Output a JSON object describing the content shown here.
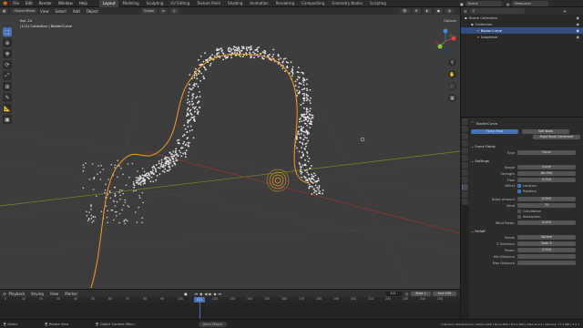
{
  "app": {
    "menus": [
      "File",
      "Edit",
      "Render",
      "Window",
      "Help"
    ],
    "workspaces": [
      "Layout",
      "Modeling",
      "Sculpting",
      "UV Editing",
      "Texture Paint",
      "Shading",
      "Animation",
      "Rendering",
      "Compositing",
      "Geometry Nodes",
      "Scripting"
    ],
    "active_workspace": "Layout",
    "scene_label": "Scene",
    "view_layer_label": "ViewLayer"
  },
  "viewport": {
    "mode": "Object Mode",
    "view_menus": [
      "View",
      "Select",
      "Add",
      "Object"
    ],
    "transform": "Global",
    "options_label": "Options",
    "fps_text": "fps: 24",
    "collection_text": "(111) Collection | BezierCurve"
  },
  "outliner": {
    "rows": [
      {
        "label": "Scene Collection",
        "indent": 0,
        "selected": false
      },
      {
        "label": "Collection",
        "indent": 1,
        "selected": false
      },
      {
        "label": "BezierCurve",
        "indent": 2,
        "selected": true
      },
      {
        "label": "Icosphere",
        "indent": 2,
        "selected": false
      }
    ]
  },
  "properties": {
    "object_name": "BezierCurve",
    "physics_buttons": [
      "Force Field",
      "Soft Body",
      "Rigid Body Constraint"
    ],
    "force_fields_header": "Force Fields",
    "type_label": "Type",
    "type_value": "Force",
    "settings_header": "Settings",
    "settings": [
      {
        "label": "Shape",
        "value": "Curve"
      },
      {
        "label": "Strength",
        "value": "80.000"
      },
      {
        "label": "Flow",
        "value": "0.000"
      }
    ],
    "affect_label": "Affect",
    "checks": [
      {
        "label": "Location",
        "on": true
      },
      {
        "label": "Rotation",
        "on": true
      }
    ],
    "noise_rows": [
      {
        "label": "Noise Amount",
        "value": "0.000"
      },
      {
        "label": "Seed",
        "value": "75"
      }
    ],
    "checks2": [
      {
        "label": "Gravitation",
        "on": false
      },
      {
        "label": "Absorption",
        "on": false
      }
    ],
    "wind_row": {
      "label": "Wind Factor",
      "value": "0.000"
    },
    "falloff_header": "Falloff",
    "falloff": [
      {
        "label": "Shape",
        "value": "Sphere"
      },
      {
        "label": "Z Direction",
        "value": "Both Z"
      },
      {
        "label": "Power",
        "value": "0.000"
      },
      {
        "label": "Min Distance",
        "value": ""
      },
      {
        "label": "Max Distance",
        "value": ""
      }
    ]
  },
  "timeline": {
    "menus": [
      "Playback",
      "Keying",
      "View",
      "Marker"
    ],
    "current_frame": "111",
    "start_label": "Start",
    "start_value": "1",
    "end_label": "End",
    "end_value": "250",
    "ruler": [
      "0",
      "10",
      "20",
      "30",
      "40",
      "50",
      "60",
      "70",
      "80",
      "90",
      "100",
      "110",
      "120",
      "130",
      "140",
      "150",
      "160",
      "170",
      "180",
      "190",
      "200",
      "210",
      "220",
      "230",
      "240",
      "250"
    ]
  },
  "status": {
    "select": "Select",
    "box_select": "Rotate View",
    "context_menu": "Object Context Menu",
    "center_chip": "Anim Player",
    "stats": "Collection | BezierCurve | Verts:1,000 | Faces:800 | Tris:1,600 | Objects:1/2 | Memory: 17.3 MiB | 3.2.1"
  },
  "colors": {
    "accent": "#4772b3",
    "curve": "#f0a030",
    "particles": "#e6e6e6",
    "playhead": "#4772b3"
  }
}
